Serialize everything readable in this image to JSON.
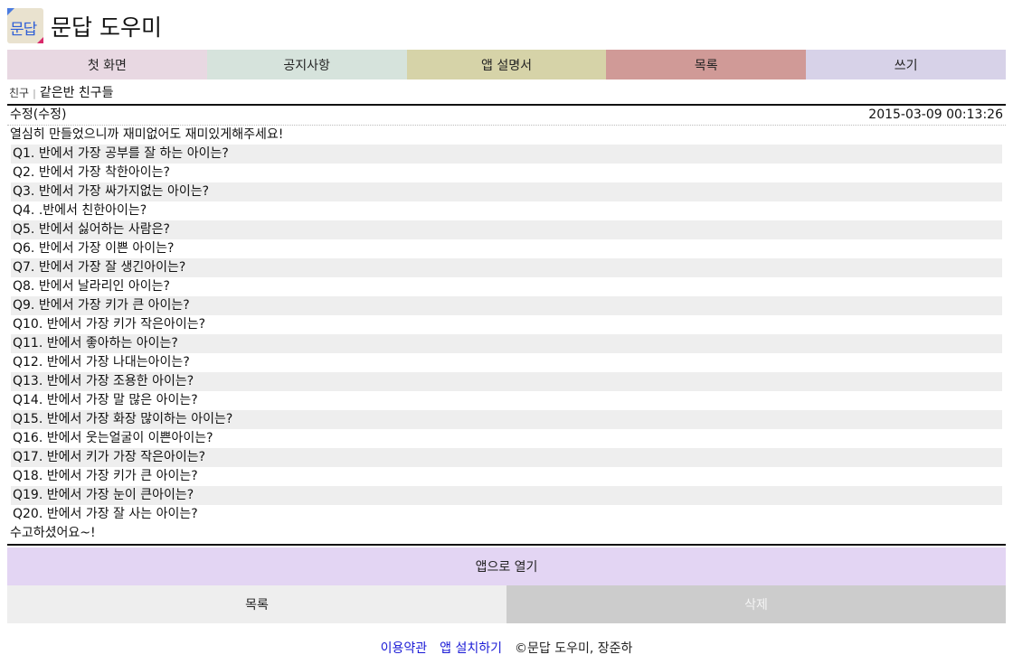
{
  "header": {
    "logo_text": "문답",
    "site_title": "문답 도우미"
  },
  "nav": [
    {
      "label": "첫 화면",
      "color": "#e8d8e2"
    },
    {
      "label": "공지사항",
      "color": "#d6e3dc"
    },
    {
      "label": "앱 설명서",
      "color": "#d6d3a8"
    },
    {
      "label": "목록",
      "color": "#d09a97"
    },
    {
      "label": "쓰기",
      "color": "#d7d2e8"
    }
  ],
  "breadcrumb": {
    "category": "친구",
    "separator": "|",
    "title": "같은반 친구들"
  },
  "post": {
    "author": "수정(수정)",
    "timestamp": "2015-03-09 00:13:26",
    "intro": "열심히 만들었으니까 재미없어도 재미있게해주세요!",
    "questions": [
      "Q1. 반에서 가장 공부를 잘 하는 아이는?",
      "Q2. 반에서 가장 착한아이는?",
      "Q3. 반에서 가장 싸가지없는 아이는?",
      "Q4. .반에서 친한아이는?",
      "Q5. 반에서 싫어하는 사람은?",
      "Q6. 반에서 가장 이쁜 아이는?",
      "Q7. 반에서 가장 잘 생긴아이는?",
      "Q8. 반에서 날라리인 아이는?",
      "Q9. 반에서 가장 키가 큰 아이는?",
      "Q10. 반에서 가장 키가 작은아이는?",
      "Q11. 반에서 좋아하는 아이는?",
      "Q12. 반에서 가장 나대는아이는?",
      "Q13. 반에서 가장 조용한 아이는?",
      "Q14. 반에서 가장 말 많은 아이는?",
      "Q15. 반에서 가장 화장 많이하는 아이는?",
      "Q16. 반에서 웃는얼굴이 이쁜아이는?",
      "Q17. 반에서 키가 가장 작은아이는?",
      "Q18. 반에서 가장 키가 큰 아이는?",
      "Q19. 반에서 가장 눈이 큰아이는?",
      "Q20. 반에서 가장 잘 사는 아이는?"
    ],
    "outro": "수고하셨어요~!"
  },
  "actions": {
    "open_app": "앱으로 열기",
    "list": "목록",
    "delete": "삭제"
  },
  "footer": {
    "terms": "이용약관",
    "install": "앱 설치하기",
    "copyright": "©문답 도우미, 장준하"
  }
}
